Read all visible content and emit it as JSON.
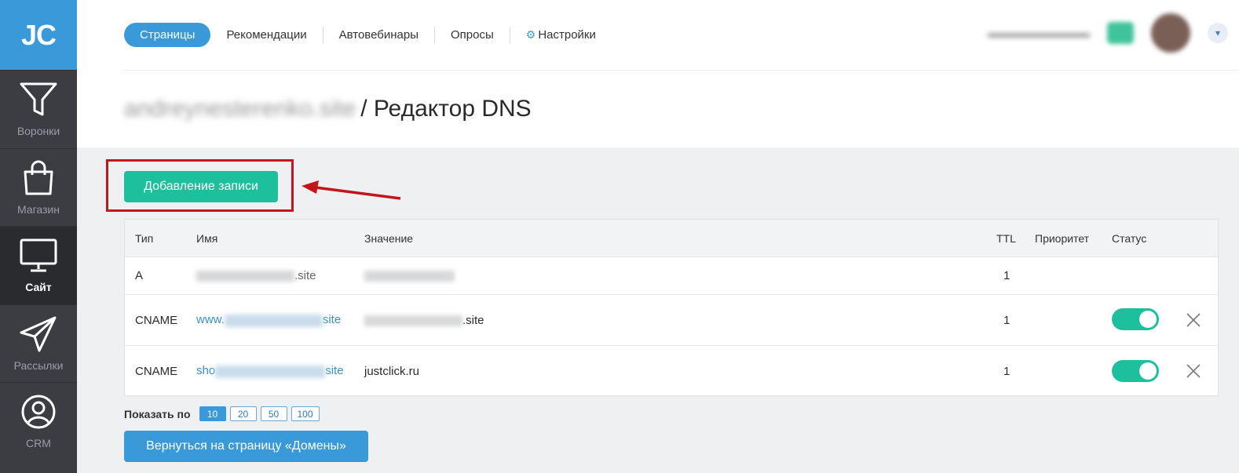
{
  "logo": "JC",
  "sidebar": {
    "items": [
      {
        "label": "Воронки",
        "icon": "funnel-icon"
      },
      {
        "label": "Магазин",
        "icon": "bag-icon"
      },
      {
        "label": "Сайт",
        "icon": "monitor-icon",
        "active": true
      },
      {
        "label": "Рассылки",
        "icon": "paper-plane-icon"
      },
      {
        "label": "CRM",
        "icon": "user-circle-icon"
      }
    ]
  },
  "topnav": {
    "tabs": [
      "Страницы",
      "Рекомендации",
      "Автовебинары",
      "Опросы",
      "Настройки"
    ]
  },
  "header": {
    "title_suffix": "/ Редактор DNS",
    "domain_blurred": "andreynesterenko.site"
  },
  "actions": {
    "add_record": "Добавление записи",
    "back": "Вернуться на страницу «Домены»"
  },
  "table": {
    "columns": [
      "Тип",
      "Имя",
      "Значение",
      "TTL",
      "Приоритет",
      "Статус"
    ],
    "rows": [
      {
        "type": "A",
        "name_suffix": ".site",
        "ttl": "1"
      },
      {
        "type": "CNAME",
        "name_prefix": "www.",
        "name_suffix": "site",
        "value_suffix": ".site",
        "ttl": "1"
      },
      {
        "type": "CNAME",
        "name_prefix": "sho",
        "name_suffix": "site",
        "value": "justclick.ru",
        "ttl": "1"
      }
    ]
  },
  "pager": {
    "label": "Показать по",
    "options": [
      "10",
      "20",
      "50",
      "100"
    ],
    "selected": "10"
  },
  "colors": {
    "accent": "#3a9ad9",
    "green": "#1dbf9d",
    "highlight": "#c0161c"
  }
}
